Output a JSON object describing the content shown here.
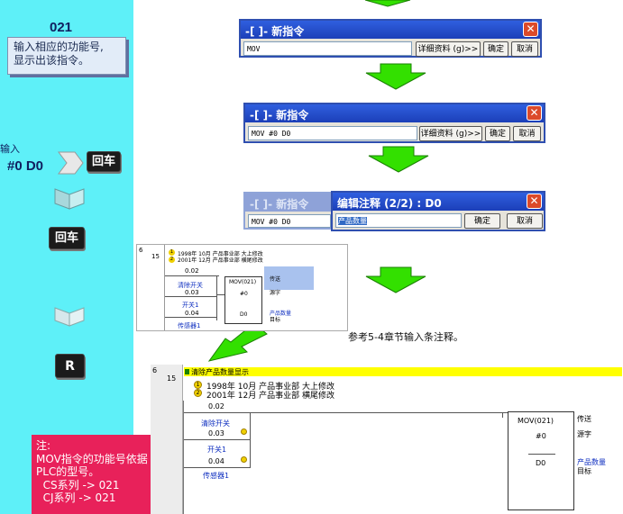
{
  "sidebar": {
    "step_number": "021",
    "tip_lines": [
      "输入相应的功能号,",
      "显示出该指令。"
    ],
    "input_label": "输入",
    "key_text": "#0 D0",
    "enter_label": "回车",
    "r_label": "R",
    "note_lines": [
      "注:",
      "MOV指令的功能号依据",
      "PLC的型号。",
      "  CS系列 -> 021",
      "  CJ系列 -> 021"
    ]
  },
  "dialog1": {
    "title": "-[ ]- 新指令",
    "input_value": "MOV",
    "details_label": "详细资料 (g)>>",
    "ok_label": "确定",
    "cancel_label": "取消"
  },
  "dialog2": {
    "title": "-[ ]- 新指令",
    "input_value": "MOV #0 D0",
    "details_label": "详细资料 (g)>>",
    "ok_label": "确定",
    "cancel_label": "取消"
  },
  "dialog3": {
    "title": "-[ ]- 新指令",
    "input_value": "MOV #0 D0"
  },
  "dialog4": {
    "title": "编辑注释 (2/2) : D0",
    "input_value": "产品数量",
    "ok_label": "确定",
    "cancel_label": "取消"
  },
  "reference_text": "参考5-4章节输入条注释。",
  "ladder_small": {
    "rung_num": "6",
    "step_num": "15",
    "history": [
      "1998年 10月 产品事业部 大上修改",
      "2001年 12月 产品事业部 横尾修改"
    ],
    "contacts": [
      "0.02",
      "0.03",
      "0.04"
    ],
    "contact_labels": [
      "清除开关",
      "开关1",
      "传感器1"
    ],
    "instruction": "MOV(021)",
    "operand1": "#0",
    "operand2": "D0",
    "right_labels": [
      "传送",
      "源字",
      "产品数量",
      "目标"
    ],
    "markers": [
      "1",
      "2"
    ]
  },
  "ladder_big": {
    "rung_num": "6",
    "step_num": "15",
    "rung_comment": "清除产品数量显示",
    "history": [
      "1998年 10月 产品事业部 大上修改",
      "2001年 12月 产品事业部 横尾修改"
    ],
    "contacts": [
      "0.02",
      "0.03",
      "0.04"
    ],
    "contact_labels": [
      "清除开关",
      "开关1",
      "传感器1"
    ],
    "instruction": "MOV(021)",
    "operand1": "#0",
    "operand2": "D0",
    "right_labels": [
      "传送",
      "源字",
      "产品数量",
      "目标"
    ],
    "markers": [
      "1",
      "2"
    ]
  },
  "colors": {
    "sidebar": "#5ef0f8",
    "note_bg": "#e8215a",
    "arrow_green": "#33e000",
    "title_blue": "#1c3fb8",
    "highlight": "#ffff00"
  }
}
